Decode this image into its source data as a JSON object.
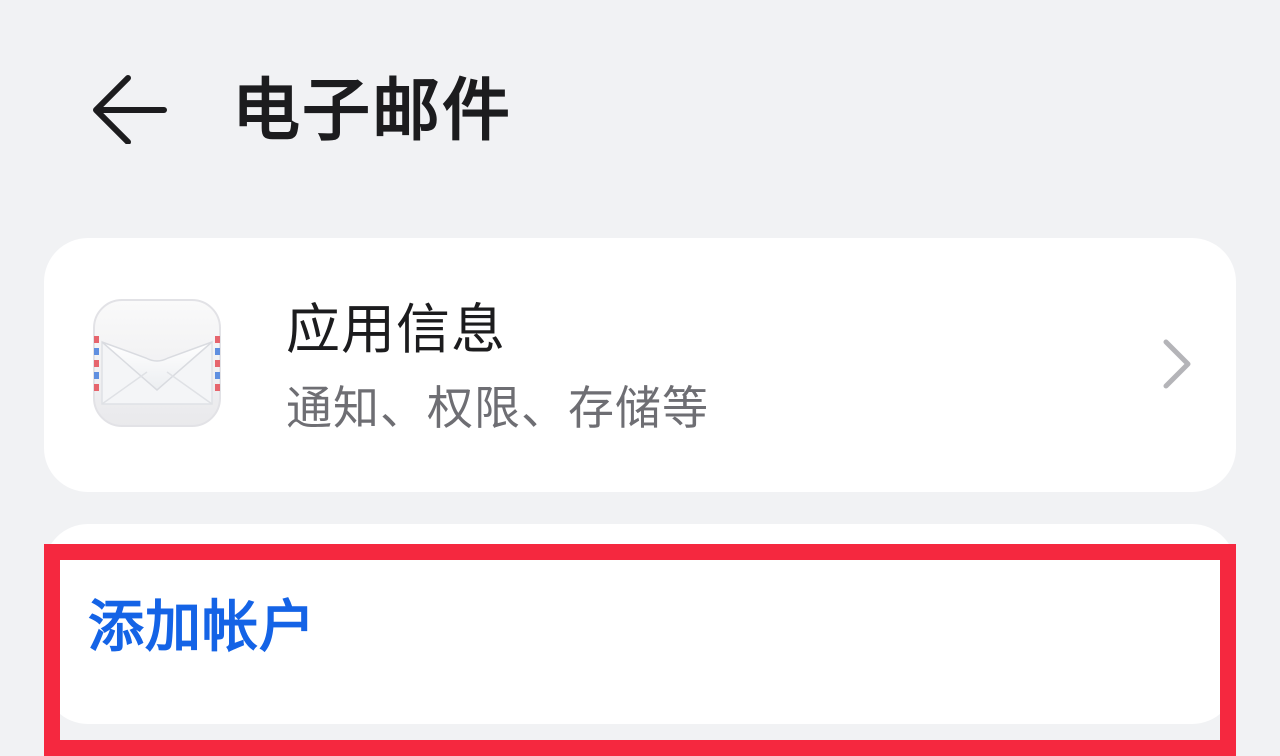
{
  "header": {
    "title": "电子邮件",
    "back_icon": "arrow-left-icon"
  },
  "app_info": {
    "title": "应用信息",
    "subtitle": "通知、权限、存储等",
    "icon": "mail-envelope-icon",
    "chevron_icon": "chevron-right-icon"
  },
  "accounts": {
    "add_account_label": "添加帐户"
  },
  "colors": {
    "background": "#f1f2f4",
    "card": "#ffffff",
    "accent": "#1463e6",
    "highlight": "#f5283f",
    "title_text": "#1c1c1e",
    "secondary_text": "#6e6e73"
  }
}
